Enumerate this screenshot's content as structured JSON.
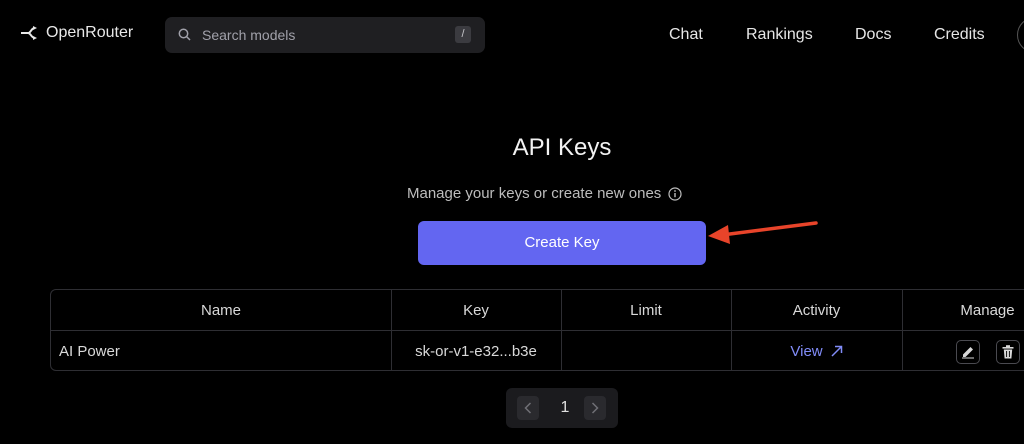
{
  "header": {
    "logo_text": "OpenRouter",
    "search_placeholder": "Search models",
    "search_shortcut": "/",
    "nav": [
      "Chat",
      "Rankings",
      "Docs",
      "Credits"
    ]
  },
  "main": {
    "title": "API Keys",
    "subtitle": "Manage your keys or create new ones",
    "create_button": "Create Key"
  },
  "table": {
    "columns": [
      "Name",
      "Key",
      "Limit",
      "Activity",
      "Manage"
    ],
    "rows": [
      {
        "name": "AI Power",
        "key": "sk-or-v1-e32...b3e",
        "limit": "",
        "activity": "View"
      }
    ]
  },
  "pagination": {
    "current_page": "1"
  },
  "colors": {
    "accent": "#6366f1",
    "link": "#818cf8",
    "annotation_arrow": "#e8442a",
    "background": "#000000"
  }
}
